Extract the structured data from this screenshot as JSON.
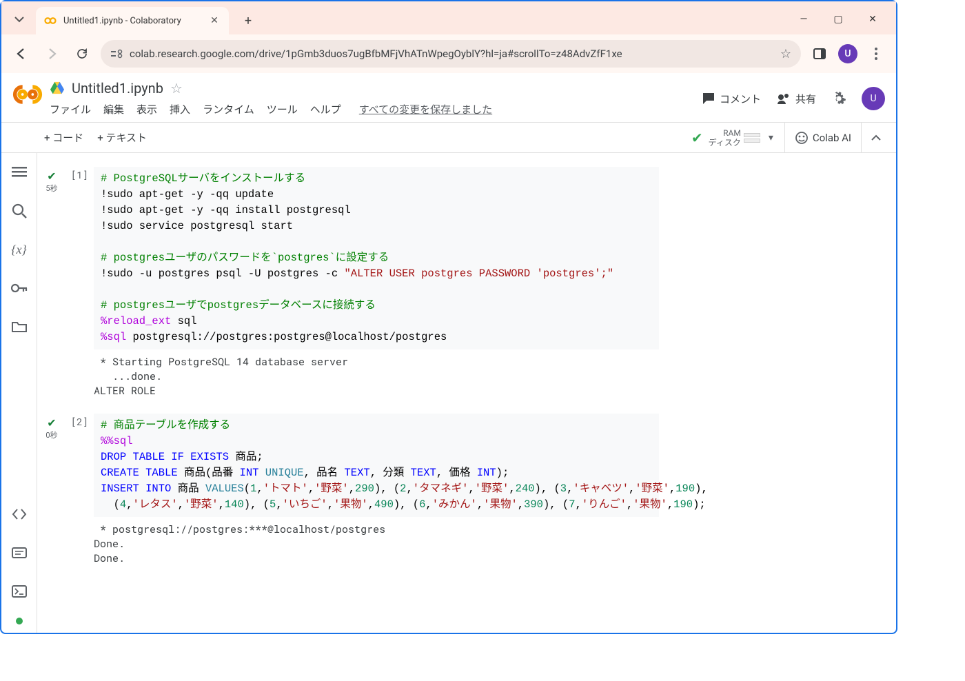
{
  "browser": {
    "tab_title": "Untitled1.ipynb - Colaboratory",
    "url": "colab.research.google.com/drive/1pGmb3duos7ugBfbMFjVhATnWpegOyblY?hl=ja#scrollTo=z48AdvZfF1xe",
    "avatar_letter": "U"
  },
  "colab": {
    "doc_title": "Untitled1.ipynb",
    "menus": [
      "ファイル",
      "編集",
      "表示",
      "挿入",
      "ランタイム",
      "ツール",
      "ヘルプ"
    ],
    "save_message": "すべての変更を保存しました",
    "comment_label": "コメント",
    "share_label": "共有",
    "insert_code": "+ コード",
    "insert_text": "+ テキスト",
    "ram_label": "RAM",
    "disk_label": "ディスク",
    "colab_ai_label": "Colab AI",
    "avatar_letter": "U"
  },
  "cells": [
    {
      "exec_count": "[1]",
      "gutter_time": "5秒",
      "code_lines": [
        [
          {
            "t": "# PostgreSQLサーバをインストールする",
            "cls": "c-comment"
          }
        ],
        [
          {
            "t": "!sudo apt-get -y -qq update"
          }
        ],
        [
          {
            "t": "!sudo apt-get -y -qq install postgresql"
          }
        ],
        [
          {
            "t": "!sudo service postgresql start"
          }
        ],
        [
          {
            "t": ""
          }
        ],
        [
          {
            "t": "# postgresユーザのパスワードを`postgres`に設定する",
            "cls": "c-comment"
          }
        ],
        [
          {
            "t": "!sudo -u postgres psql -U postgres -c "
          },
          {
            "t": "\"ALTER USER postgres PASSWORD 'postgres';\"",
            "cls": "c-str"
          }
        ],
        [
          {
            "t": ""
          }
        ],
        [
          {
            "t": "# postgresユーザでpostgresデータベースに接続する",
            "cls": "c-comment"
          }
        ],
        [
          {
            "t": "%reload_ext",
            "cls": "c-magic"
          },
          {
            "t": " sql"
          }
        ],
        [
          {
            "t": "%sql",
            "cls": "c-magic"
          },
          {
            "t": " postgresql://postgres:postgres@localhost/postgres"
          }
        ]
      ],
      "output": " * Starting PostgreSQL 14 database server\n   ...done.\nALTER ROLE"
    },
    {
      "exec_count": "[2]",
      "gutter_time": "0秒",
      "code_lines": [
        [
          {
            "t": "# 商品テーブルを作成する",
            "cls": "c-comment"
          }
        ],
        [
          {
            "t": "%%sql",
            "cls": "c-magic"
          }
        ],
        [
          {
            "t": "DROP",
            "cls": "c-sqlkw"
          },
          {
            "t": " "
          },
          {
            "t": "TABLE",
            "cls": "c-sqlkw"
          },
          {
            "t": " "
          },
          {
            "t": "IF",
            "cls": "c-sqlkw"
          },
          {
            "t": " "
          },
          {
            "t": "EXISTS",
            "cls": "c-sqlkw"
          },
          {
            "t": " 商品;"
          }
        ],
        [
          {
            "t": "CREATE",
            "cls": "c-sqlkw"
          },
          {
            "t": " "
          },
          {
            "t": "TABLE",
            "cls": "c-sqlkw"
          },
          {
            "t": " 商品(品番 "
          },
          {
            "t": "INT",
            "cls": "c-sqlkw"
          },
          {
            "t": " "
          },
          {
            "t": "UNIQUE",
            "cls": "c-ident"
          },
          {
            "t": ", 品名 "
          },
          {
            "t": "TEXT",
            "cls": "c-sqlkw"
          },
          {
            "t": ", 分類 "
          },
          {
            "t": "TEXT",
            "cls": "c-sqlkw"
          },
          {
            "t": ", 価格 "
          },
          {
            "t": "INT",
            "cls": "c-sqlkw"
          },
          {
            "t": ");"
          }
        ],
        [
          {
            "t": "INSERT",
            "cls": "c-sqlkw"
          },
          {
            "t": " "
          },
          {
            "t": "INTO",
            "cls": "c-sqlkw"
          },
          {
            "t": " 商品 "
          },
          {
            "t": "VALUES",
            "cls": "c-ident"
          },
          {
            "t": "("
          },
          {
            "t": "1",
            "cls": "c-num"
          },
          {
            "t": ","
          },
          {
            "t": "'トマト'",
            "cls": "c-str"
          },
          {
            "t": ","
          },
          {
            "t": "'野菜'",
            "cls": "c-str"
          },
          {
            "t": ","
          },
          {
            "t": "290",
            "cls": "c-num"
          },
          {
            "t": "), ("
          },
          {
            "t": "2",
            "cls": "c-num"
          },
          {
            "t": ","
          },
          {
            "t": "'タマネギ'",
            "cls": "c-str"
          },
          {
            "t": ","
          },
          {
            "t": "'野菜'",
            "cls": "c-str"
          },
          {
            "t": ","
          },
          {
            "t": "240",
            "cls": "c-num"
          },
          {
            "t": "), ("
          },
          {
            "t": "3",
            "cls": "c-num"
          },
          {
            "t": ","
          },
          {
            "t": "'キャベツ'",
            "cls": "c-str"
          },
          {
            "t": ","
          },
          {
            "t": "'野菜'",
            "cls": "c-str"
          },
          {
            "t": ","
          },
          {
            "t": "190",
            "cls": "c-num"
          },
          {
            "t": "),"
          }
        ],
        [
          {
            "t": "  ("
          },
          {
            "t": "4",
            "cls": "c-num"
          },
          {
            "t": ","
          },
          {
            "t": "'レタス'",
            "cls": "c-str"
          },
          {
            "t": ","
          },
          {
            "t": "'野菜'",
            "cls": "c-str"
          },
          {
            "t": ","
          },
          {
            "t": "140",
            "cls": "c-num"
          },
          {
            "t": "), ("
          },
          {
            "t": "5",
            "cls": "c-num"
          },
          {
            "t": ","
          },
          {
            "t": "'いちご'",
            "cls": "c-str"
          },
          {
            "t": ","
          },
          {
            "t": "'果物'",
            "cls": "c-str"
          },
          {
            "t": ","
          },
          {
            "t": "490",
            "cls": "c-num"
          },
          {
            "t": "), ("
          },
          {
            "t": "6",
            "cls": "c-num"
          },
          {
            "t": ","
          },
          {
            "t": "'みかん'",
            "cls": "c-str"
          },
          {
            "t": ","
          },
          {
            "t": "'果物'",
            "cls": "c-str"
          },
          {
            "t": ","
          },
          {
            "t": "390",
            "cls": "c-num"
          },
          {
            "t": "), ("
          },
          {
            "t": "7",
            "cls": "c-num"
          },
          {
            "t": ","
          },
          {
            "t": "'りんご'",
            "cls": "c-str"
          },
          {
            "t": ","
          },
          {
            "t": "'果物'",
            "cls": "c-str"
          },
          {
            "t": ","
          },
          {
            "t": "190",
            "cls": "c-num"
          },
          {
            "t": ");"
          }
        ]
      ],
      "output": " * postgresql://postgres:***@localhost/postgres\nDone.\nDone."
    }
  ]
}
